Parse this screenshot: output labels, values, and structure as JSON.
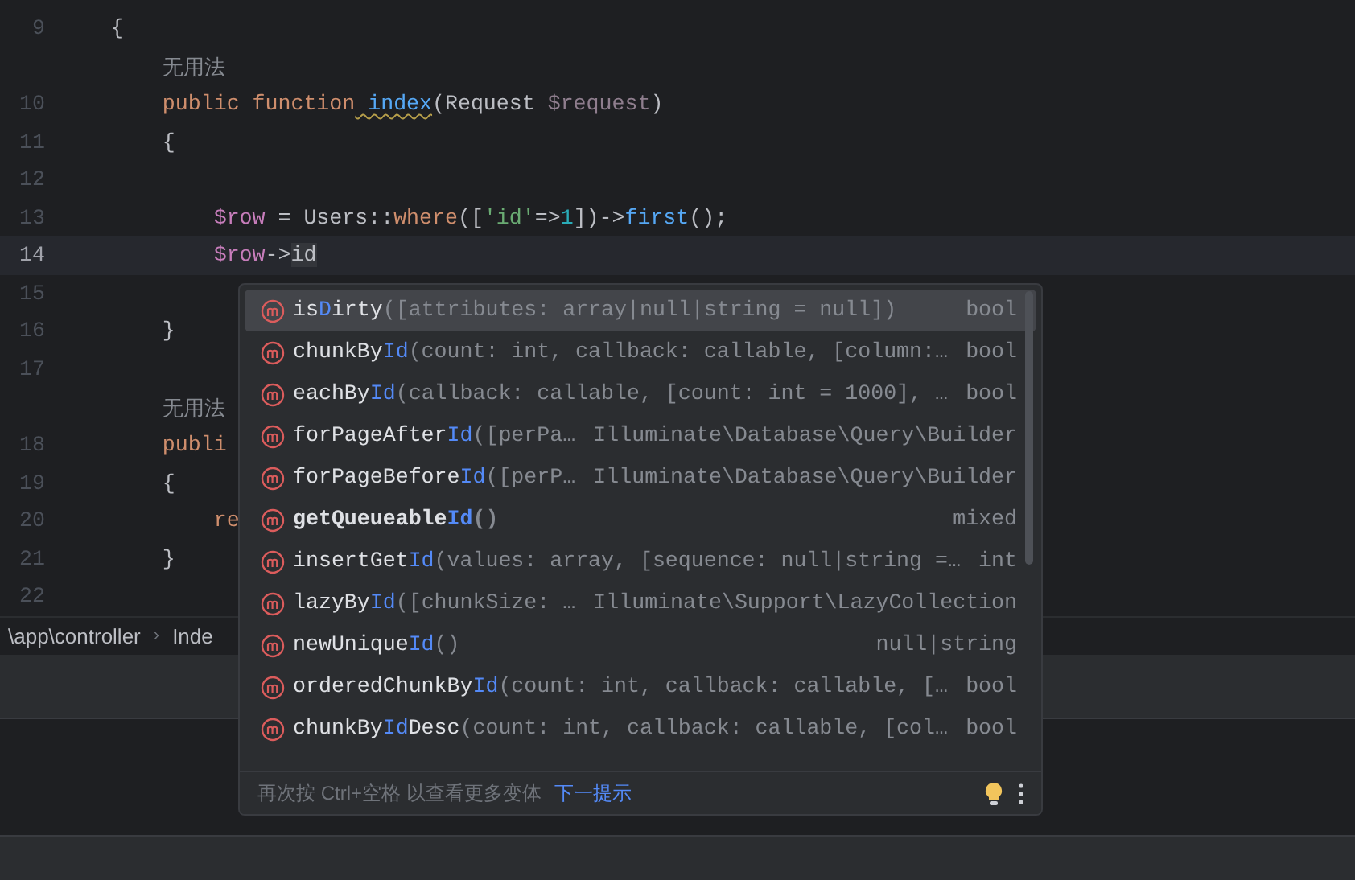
{
  "editor": {
    "lines": [
      {
        "kind": "code",
        "number": "9",
        "current": false,
        "tokens": [
          {
            "text": "{",
            "kind": "plain"
          }
        ]
      },
      {
        "kind": "hint",
        "text": "无用法"
      },
      {
        "kind": "code",
        "number": "10",
        "current": false,
        "tokens": [
          {
            "text": "    public",
            "kind": "keyword"
          },
          {
            "text": " function",
            "kind": "keyword"
          },
          {
            "text": " index",
            "kind": "warned"
          },
          {
            "text": "(Request ",
            "kind": "plain"
          },
          {
            "text": "$request",
            "kind": "unused"
          },
          {
            "text": ")",
            "kind": "plain"
          }
        ]
      },
      {
        "kind": "code",
        "number": "11",
        "current": false,
        "tokens": [
          {
            "text": "    {",
            "kind": "plain"
          }
        ]
      },
      {
        "kind": "code",
        "number": "12",
        "current": false
      },
      {
        "kind": "code",
        "number": "13",
        "current": false,
        "tokens": [
          {
            "text": "        $row",
            "kind": "variable"
          },
          {
            "text": " = Users::",
            "kind": "plain"
          },
          {
            "text": "where",
            "kind": "method"
          },
          {
            "text": "([",
            "kind": "plain"
          },
          {
            "text": "'id'",
            "kind": "string"
          },
          {
            "text": "=>",
            "kind": "plain"
          },
          {
            "text": "1",
            "kind": "number"
          },
          {
            "text": "])->",
            "kind": "plain"
          },
          {
            "text": "first",
            "kind": "function"
          },
          {
            "text": "();",
            "kind": "plain"
          }
        ]
      },
      {
        "kind": "code",
        "number": "14",
        "current": true,
        "tokens": [
          {
            "text": "        $row",
            "kind": "variable"
          },
          {
            "text": "->",
            "kind": "plain"
          },
          {
            "text": "id",
            "kind": "typed"
          }
        ]
      },
      {
        "kind": "code",
        "number": "15",
        "current": false
      },
      {
        "kind": "code",
        "number": "16",
        "current": false,
        "tokens": [
          {
            "text": "    }",
            "kind": "plain"
          }
        ]
      },
      {
        "kind": "code",
        "number": "17",
        "current": false
      },
      {
        "kind": "hint",
        "text": "无用法"
      },
      {
        "kind": "code",
        "number": "18",
        "current": false,
        "tokens": [
          {
            "text": "    publi",
            "kind": "keyword"
          }
        ]
      },
      {
        "kind": "code",
        "number": "19",
        "current": false,
        "tokens": [
          {
            "text": "    {",
            "kind": "plain"
          }
        ]
      },
      {
        "kind": "code",
        "number": "20",
        "current": false,
        "tokens": [
          {
            "text": "        re",
            "kind": "keyword"
          }
        ]
      },
      {
        "kind": "code",
        "number": "21",
        "current": false,
        "tokens": [
          {
            "text": "    }",
            "kind": "plain"
          }
        ]
      },
      {
        "kind": "code",
        "number": "22",
        "current": false
      }
    ]
  },
  "breadcrumbs": {
    "separator": "›",
    "items": [
      "\\app\\controller",
      "Inde"
    ]
  },
  "completion": {
    "items": [
      {
        "name": [
          {
            "text": "is",
            "match": false
          },
          {
            "text": "D",
            "match": true
          },
          {
            "text": "irty",
            "match": false
          }
        ],
        "params": "([attributes: array|null|string = null])",
        "type": "bool",
        "selected": true,
        "bold": false
      },
      {
        "name": [
          {
            "text": "chunkBy",
            "match": false
          },
          {
            "text": "Id",
            "match": true
          }
        ],
        "params": "(count: int, callback: callable, [column:…",
        "type": "bool",
        "selected": false,
        "bold": false
      },
      {
        "name": [
          {
            "text": "eachBy",
            "match": false
          },
          {
            "text": "Id",
            "match": true
          }
        ],
        "params": "(callback: callable, [count: int = 1000], …",
        "type": "bool",
        "selected": false,
        "bold": false
      },
      {
        "name": [
          {
            "text": "forPageAfter",
            "match": false
          },
          {
            "text": "Id",
            "match": true
          }
        ],
        "params": "([perPa…",
        "type": "Illuminate\\Database\\Query\\Builder",
        "selected": false,
        "bold": false
      },
      {
        "name": [
          {
            "text": "forPageBefore",
            "match": false
          },
          {
            "text": "Id",
            "match": true
          }
        ],
        "params": "([perP…",
        "type": "Illuminate\\Database\\Query\\Builder",
        "selected": false,
        "bold": false
      },
      {
        "name": [
          {
            "text": "getQueueable",
            "match": false
          },
          {
            "text": "Id",
            "match": true
          }
        ],
        "params": "()",
        "type": "mixed",
        "selected": false,
        "bold": true
      },
      {
        "name": [
          {
            "text": "insertGet",
            "match": false
          },
          {
            "text": "Id",
            "match": true
          }
        ],
        "params": "(values: array, [sequence: null|string =…",
        "type": "int",
        "selected": false,
        "bold": false
      },
      {
        "name": [
          {
            "text": "lazyBy",
            "match": false
          },
          {
            "text": "Id",
            "match": true
          }
        ],
        "params": "([chunkSize: …",
        "type": "Illuminate\\Support\\LazyCollection",
        "selected": false,
        "bold": false
      },
      {
        "name": [
          {
            "text": "newUnique",
            "match": false
          },
          {
            "text": "Id",
            "match": true
          }
        ],
        "params": "()",
        "type": "null|string",
        "selected": false,
        "bold": false
      },
      {
        "name": [
          {
            "text": "orderedChunkBy",
            "match": false
          },
          {
            "text": "Id",
            "match": true
          }
        ],
        "params": "(count: int, callback: callable, […",
        "type": "bool",
        "selected": false,
        "bold": false
      },
      {
        "name": [
          {
            "text": "chunkBy",
            "match": false
          },
          {
            "text": "Id",
            "match": true
          },
          {
            "text": "Desc",
            "match": false
          }
        ],
        "params": "(count: int, callback: callable, [col…",
        "type": "bool",
        "selected": false,
        "bold": false
      }
    ],
    "footer": {
      "hint": "再次按 Ctrl+空格 以查看更多变体",
      "link": "下一提示"
    }
  }
}
